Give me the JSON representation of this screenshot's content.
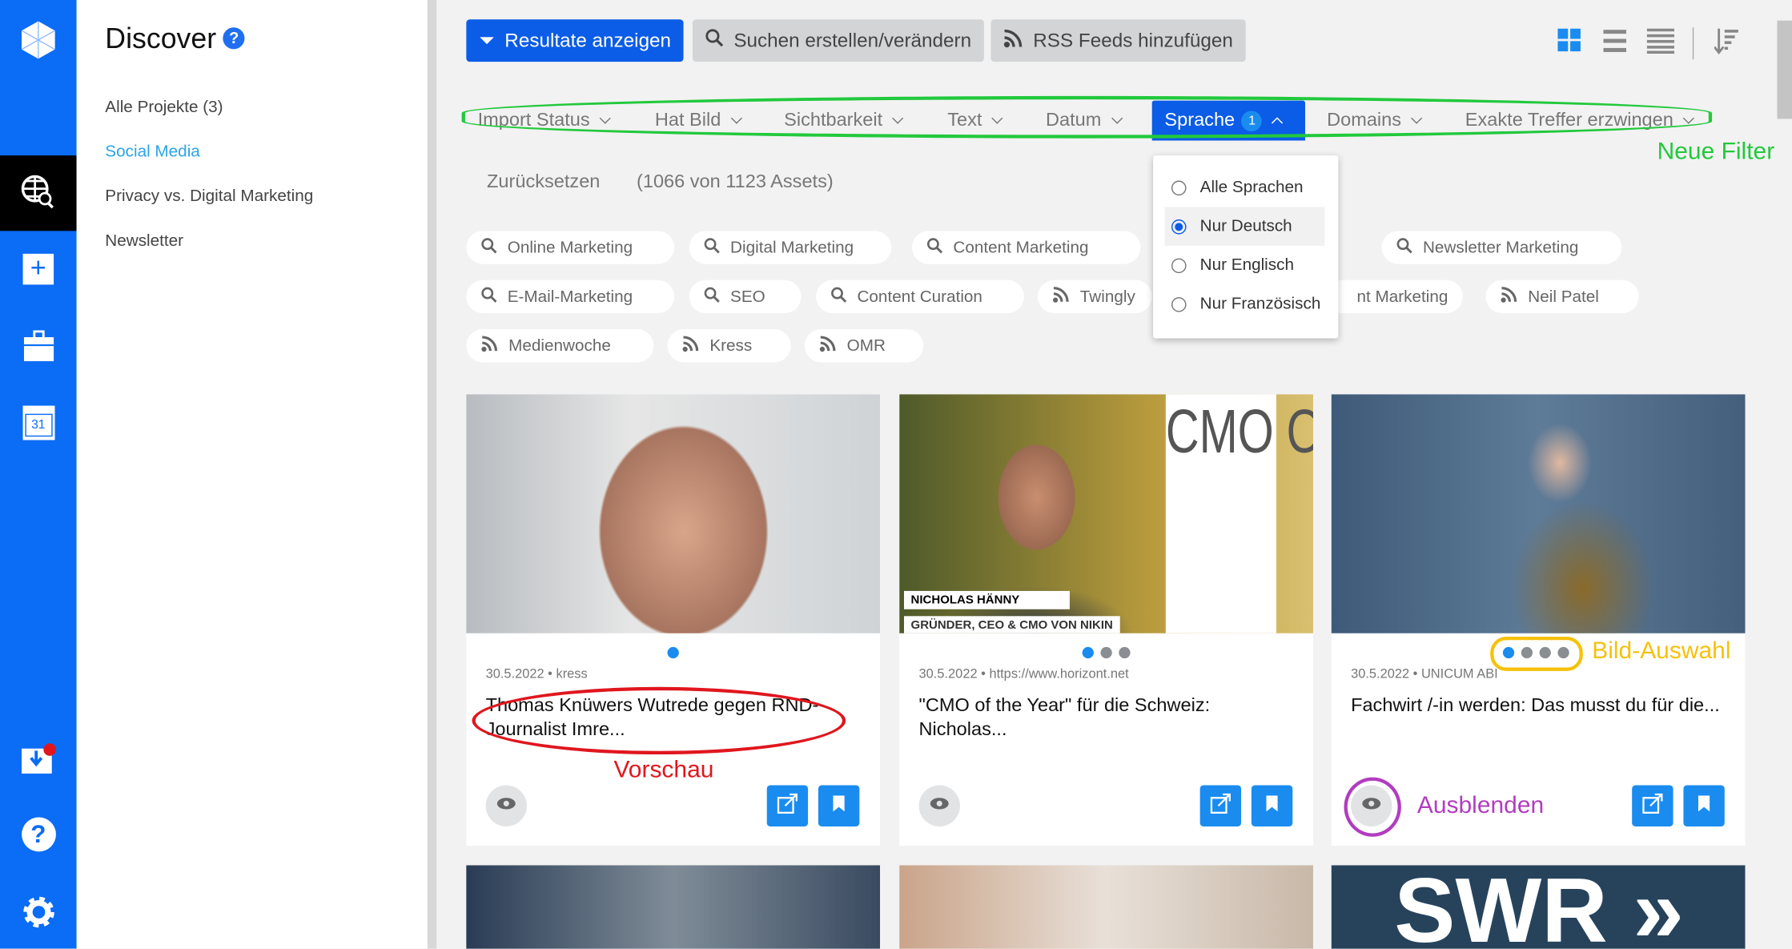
{
  "rail": {
    "icons": [
      "logo-cube-icon",
      "discover-globe-search-icon",
      "add-icon",
      "briefcase-icon",
      "calendar-icon",
      "inbox-download-icon",
      "help-icon",
      "settings-gear-icon"
    ],
    "calendar_day": "31",
    "accent": "#0b6cf5"
  },
  "panel": {
    "title": "Discover",
    "help": "?",
    "items": [
      {
        "label": "Alle Projekte (3)",
        "active": false
      },
      {
        "label": "Social Media",
        "active": true
      },
      {
        "label": "Privacy vs. Digital Marketing",
        "active": false
      },
      {
        "label": "Newsletter",
        "active": false
      }
    ]
  },
  "toolbar": {
    "show_results": "Resultate anzeigen",
    "edit_search": "Suchen erstellen/verändern",
    "add_rss": "RSS Feeds hinzufügen",
    "views": [
      "grid-view-icon",
      "list-view-icon",
      "compact-list-view-icon",
      "sort-icon"
    ],
    "active_view": "grid"
  },
  "filters": [
    {
      "label": "Import Status"
    },
    {
      "label": "Hat Bild"
    },
    {
      "label": "Sichtbarkeit"
    },
    {
      "label": "Text"
    },
    {
      "label": "Datum"
    },
    {
      "label": "Sprache",
      "badge": "1",
      "open": true
    },
    {
      "label": "Domains"
    },
    {
      "label": "Exakte Treffer erzwingen"
    }
  ],
  "reset": "Zurücksetzen",
  "count": "(1066 von 1123 Assets)",
  "language_dropdown": {
    "options": [
      "Alle Sprachen",
      "Nur Deutsch",
      "Nur Englisch",
      "Nur Französisch"
    ],
    "selected": "Nur Deutsch"
  },
  "chips": [
    {
      "label": "Online Marketing",
      "type": "search"
    },
    {
      "label": "Digital Marketing",
      "type": "search"
    },
    {
      "label": "Content Marketing",
      "type": "search"
    },
    {
      "label": "Newsletter Marketing",
      "type": "search"
    },
    {
      "label": "E-Mail-Marketing",
      "type": "search"
    },
    {
      "label": "SEO",
      "type": "search"
    },
    {
      "label": "Content Curation",
      "type": "search"
    },
    {
      "label": "Twingly",
      "type": "rss"
    },
    {
      "label": "nt Marketing",
      "type": "search"
    },
    {
      "label": "Neil Patel",
      "type": "rss"
    },
    {
      "label": "Medienwoche",
      "type": "rss"
    },
    {
      "label": "Kress",
      "type": "rss"
    },
    {
      "label": "OMR",
      "type": "rss"
    }
  ],
  "cards": [
    {
      "meta": "30.5.2022 • kress",
      "title": "Thomas Knüwers Wutrede gegen RND-Journalist Imre...",
      "images": 1,
      "active_image": 0
    },
    {
      "meta": "30.5.2022 • https://www.horizont.net",
      "title": "\"CMO of the Year\" für die Schweiz: Nicholas...",
      "images": 3,
      "active_image": 0,
      "image_caption_name": "NICHOLAS HÄNNY",
      "image_caption_role": "GRÜNDER, CEO & CMO VON NIKIN",
      "image_text": "CMO OF THE YEAR"
    },
    {
      "meta": "30.5.2022 • UNICUM ABI",
      "title": "Fachwirt /-in werden: Das musst du für die...",
      "images": 4,
      "active_image": 0
    }
  ],
  "second_row": {
    "image_text": "SWR"
  },
  "annotations": {
    "filters": "Neue Filter",
    "preview": "Vorschau",
    "image_select": "Bild-Auswahl",
    "hide": "Ausblenden",
    "colors": {
      "green": "#22c93c",
      "red": "#e0161e",
      "yellow": "#f7c10b",
      "purple": "#b23cc0"
    }
  }
}
